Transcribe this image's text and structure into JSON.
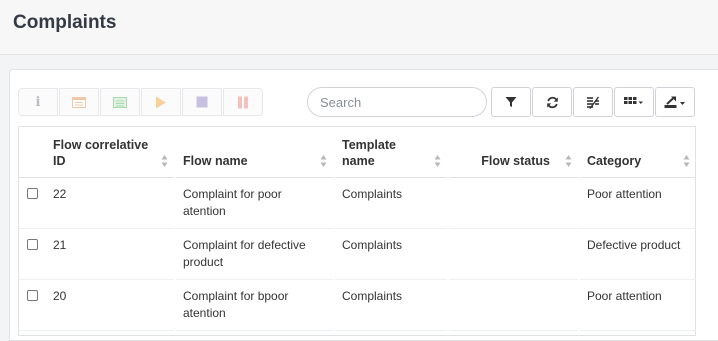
{
  "page": {
    "title": "Complaints"
  },
  "toolbar": {
    "buttons": [
      {
        "name": "info-button",
        "icon": "info-icon",
        "glyph": "i",
        "color": "#b8bcc2"
      },
      {
        "name": "form-button",
        "icon": "form-icon",
        "glyph": "",
        "color": "#f0c8a8"
      },
      {
        "name": "sheet-button",
        "icon": "sheet-icon",
        "glyph": "",
        "color": "#a8d8b0"
      },
      {
        "name": "play-button",
        "icon": "play-icon",
        "glyph": "",
        "color": "#f7d19a"
      },
      {
        "name": "stop-button",
        "icon": "stop-icon",
        "glyph": "",
        "color": "#c8c0e0"
      },
      {
        "name": "pause-button",
        "icon": "pause-icon",
        "glyph": "",
        "color": "#f4c2bd"
      }
    ],
    "search": {
      "placeholder": "Search",
      "value": ""
    }
  },
  "table": {
    "columns": [
      "Flow correlative ID",
      "Flow name",
      "Template name",
      "Flow status",
      "Category"
    ],
    "rows": [
      {
        "id": "22",
        "flow_name": "Complaint for poor atention",
        "template": "Complaints",
        "status": "",
        "category": "Poor attention"
      },
      {
        "id": "21",
        "flow_name": "Complaint for defective product",
        "template": "Complaints",
        "status": "",
        "category": "Defective product"
      },
      {
        "id": "20",
        "flow_name": "Complaint for bpoor atention",
        "template": "Complaints",
        "status": "",
        "category": "Poor attention"
      }
    ]
  }
}
